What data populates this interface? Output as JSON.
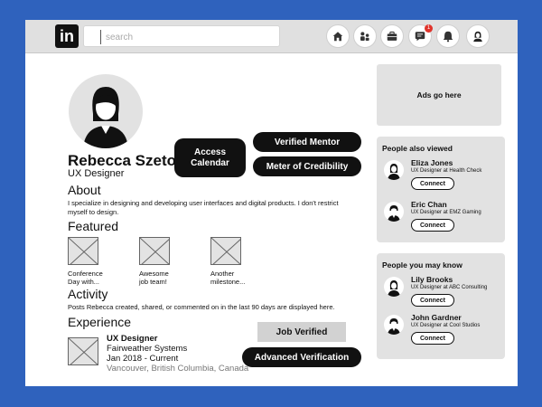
{
  "app": {
    "logo_text": "in"
  },
  "search": {
    "placeholder": "search"
  },
  "nav": {
    "icons": [
      "home-icon",
      "network-icon",
      "jobs-icon",
      "messaging-icon",
      "notifications-icon",
      "me-icon"
    ],
    "messaging_badge": "1"
  },
  "profile": {
    "name": "Rebecca Szeto",
    "title": "UX Designer",
    "about_heading": "About",
    "about_text": "I specialize in designing and developing user interfaces and digital products. I don't restrict myself to design.",
    "featured_heading": "Featured",
    "featured": [
      {
        "caption": "Conference\nDay with..."
      },
      {
        "caption": "Awesome\njob team!"
      },
      {
        "caption": "Another\nmilestone..."
      }
    ],
    "activity_heading": "Activity",
    "activity_text": "Posts Rebecca created, shared, or commented on in the last 90 days are displayed here.",
    "experience_heading": "Experience",
    "experience": {
      "role": "UX Designer",
      "company": "Fairweather Systems",
      "dates": "Jan 2018 - Current",
      "location": "Vancouver, British Columbia, Canada"
    }
  },
  "actions": {
    "access_calendar": "Access Calendar",
    "verified_mentor": "Verified Mentor",
    "meter_of_credibility": "Meter of Credibility",
    "job_verified": "Job Verified",
    "advanced_verification": "Advanced Verification"
  },
  "sidebar": {
    "ads_text": "Ads go here",
    "also_viewed": {
      "title": "People also viewed",
      "people": [
        {
          "name": "Eliza Jones",
          "role": "UX Designer at Health Check",
          "button": "Connect"
        },
        {
          "name": "Eric Chan",
          "role": "UX Designer at EMZ Gaming",
          "button": "Connect"
        }
      ]
    },
    "may_know": {
      "title": "People you may know",
      "people": [
        {
          "name": "Lily Brooks",
          "role": "UX Designer at ABC Consulting",
          "button": "Connect"
        },
        {
          "name": "John Gardner",
          "role": "UX Designer at Cool Studios",
          "button": "Connect"
        }
      ]
    }
  },
  "colors": {
    "background": "#2f62bd",
    "topbar": "#e0e0e0",
    "panel": "#e2e2e2",
    "button_dark": "#111111",
    "badge": "#e0342b"
  }
}
